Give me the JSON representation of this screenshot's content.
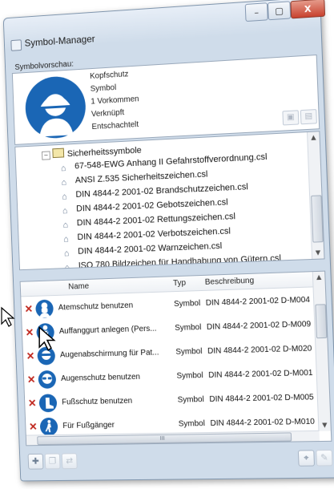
{
  "window": {
    "title": "Symbol-Manager",
    "controls": {
      "minimize": "–",
      "maximize": "▢",
      "close": "X"
    }
  },
  "preview": {
    "label": "Symbolvorschau:",
    "info": [
      "Kopfschutz",
      "Symbol",
      "1 Vorkommen",
      "Verknüpft",
      "Entschachtelt"
    ],
    "sign_color": "#1a66b5"
  },
  "tree": {
    "root": {
      "label": "Sicherheitssymbole",
      "expander": "–"
    },
    "items": [
      "67-548-EWG Anhang II Gefahrstoffverordnung.csl",
      "ANSI Z.535 Sicherheitszeichen.csl",
      "DIN 4844-2 2001-02 Brandschutzzeichen.csl",
      "DIN 4844-2 2001-02 Gebotszeichen.csl",
      "DIN 4844-2 2001-02 Rettungszeichen.csl",
      "DIN 4844-2 2001-02 Verbotszeichen.csl",
      "DIN 4844-2 2001-02 Warnzeichen.csl",
      "ISO 780 Bildzeichen für Handhabung von Gütern.csl"
    ]
  },
  "list": {
    "columns": {
      "name": "Name",
      "type": "Typ",
      "description": "Beschreibung"
    },
    "rows": [
      {
        "name": "Atemschutz benutzen",
        "type": "Symbol",
        "desc": "DIN 4844-2 2001-02 D-M004",
        "icon": "respirator-icon"
      },
      {
        "name": "Auffanggurt anlegen (Pers...",
        "type": "Symbol",
        "desc": "DIN 4844-2 2001-02 D-M009",
        "icon": "harness-icon"
      },
      {
        "name": "Augenabschirmung für Pat...",
        "type": "Symbol",
        "desc": "DIN 4844-2 2001-02 D-M020",
        "icon": "eye-shield-icon"
      },
      {
        "name": "Augenschutz benutzen",
        "type": "Symbol",
        "desc": "DIN 4844-2 2001-02 D-M001",
        "icon": "goggles-icon"
      },
      {
        "name": "Fußschutz benutzen",
        "type": "Symbol",
        "desc": "DIN 4844-2 2001-02 D-M005",
        "icon": "boot-icon"
      },
      {
        "name": "Für Fußgänger",
        "type": "Symbol",
        "desc": "DIN 4844-2 2001-02 D-M010",
        "icon": "pedestrian-icon"
      }
    ],
    "delete_glyph": "✕",
    "scroll_glyph": "III"
  },
  "colors": {
    "accent": "#1a66b5",
    "delete": "#c0271e"
  }
}
